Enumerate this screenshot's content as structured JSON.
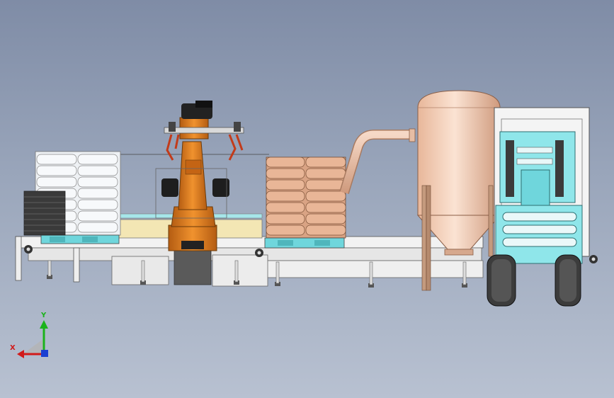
{
  "triad": {
    "x_label": "X",
    "y_label": "Y",
    "x_color": "#d11a1a",
    "y_color": "#1bb31b",
    "z_color": "#1a3fd1"
  },
  "colors": {
    "background_top": "#7f8ca6",
    "background_bottom": "#b8c1d1",
    "robot": "#e07a1c",
    "robot_dark": "#a5520e",
    "bags_white": "#eef1f4",
    "bags_orange": "#d9a384",
    "pallet": "#6fd6dc",
    "tank": "#f2cfb8",
    "forklift": "#8fe6ea",
    "conveyor": "#f2f2f2",
    "tire": "#3c3c3c"
  },
  "icons": [
    "coordinate-triad-icon",
    "robot-arm",
    "storage-tank",
    "forklift"
  ]
}
